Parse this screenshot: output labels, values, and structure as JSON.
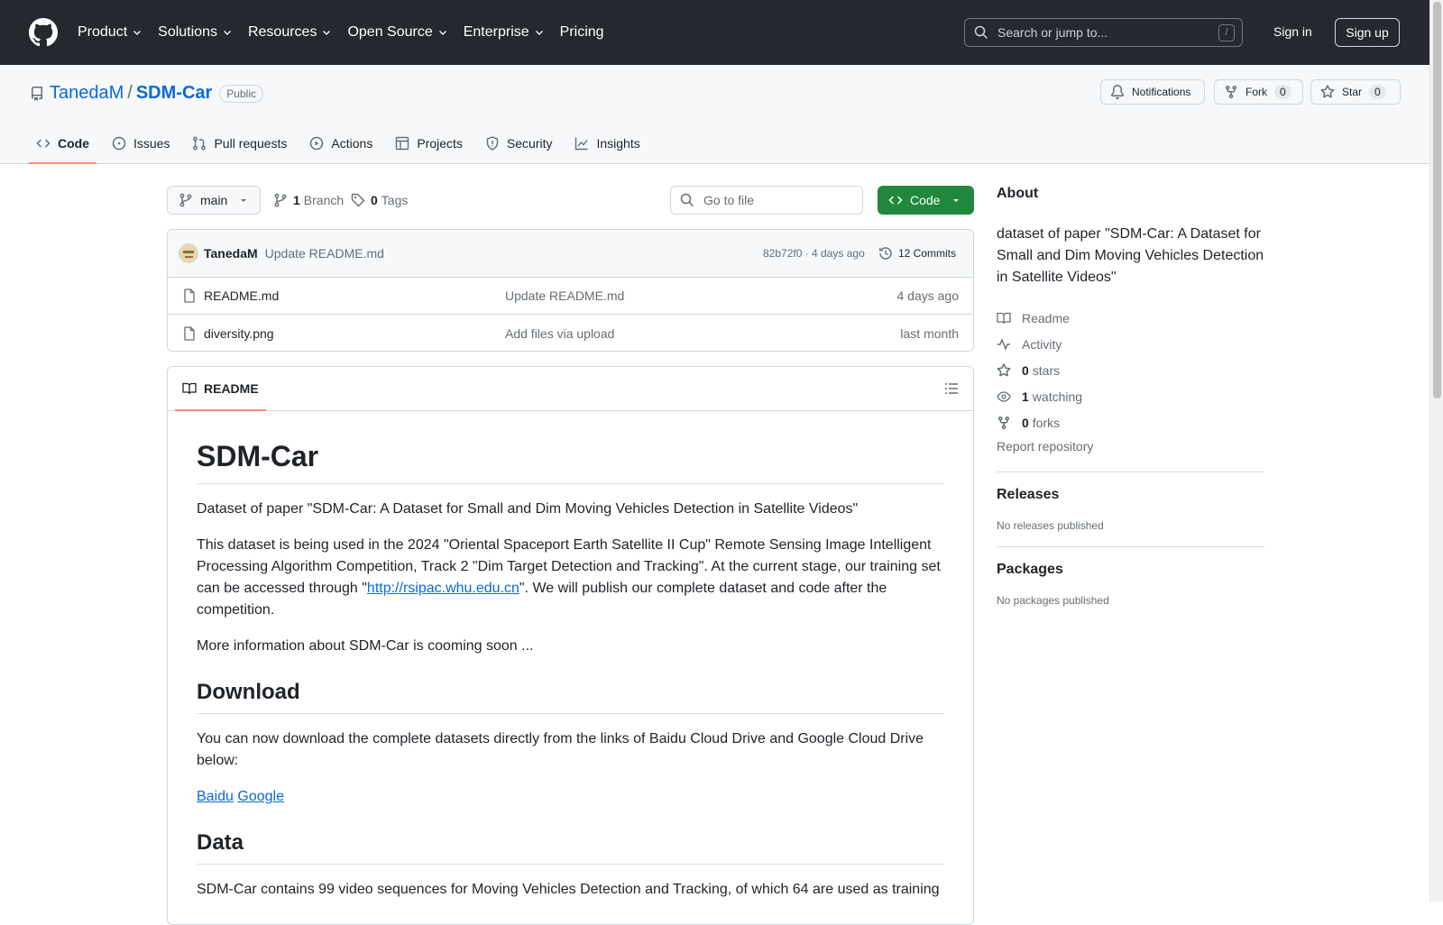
{
  "topnav": {
    "items": [
      "Product",
      "Solutions",
      "Resources",
      "Open Source",
      "Enterprise",
      "Pricing"
    ],
    "search_placeholder": "Search or jump to...",
    "search_shortcut": "/",
    "signin": "Sign in",
    "signup": "Sign up"
  },
  "repo": {
    "owner": "TanedaM",
    "separator": "/",
    "name": "SDM-Car",
    "visibility": "Public",
    "notifications": "Notifications",
    "fork_label": "Fork",
    "fork_count": "0",
    "star_label": "Star",
    "star_count": "0"
  },
  "tabs": [
    "Code",
    "Issues",
    "Pull requests",
    "Actions",
    "Projects",
    "Security",
    "Insights"
  ],
  "toolbar": {
    "branch": "main",
    "branch_count": "1",
    "branch_label": "Branch",
    "tag_count": "0",
    "tag_label": "Tags",
    "goto_placeholder": "Go to file",
    "code_button": "Code"
  },
  "latest_commit": {
    "author": "TanedaM",
    "message": "Update README.md",
    "sha_time": "82b72f0 · 4 days ago",
    "commits": "12 Commits"
  },
  "files": [
    {
      "name": "README.md",
      "message": "Update README.md",
      "date": "4 days ago"
    },
    {
      "name": "diversity.png",
      "message": "Add files via upload",
      "date": "last month"
    }
  ],
  "readme": {
    "tab": "README",
    "title": "SDM-Car",
    "p1": "Dataset of paper \"SDM-Car: A Dataset for Small and Dim Moving Vehicles Detection in Satellite Videos\"",
    "p2_before": "This dataset is being used in the 2024 \"Oriental Spaceport Earth Satellite II Cup\" Remote Sensing Image Intelligent Processing Algorithm Competition, Track 2 \"Dim Target Detection and Tracking\". At the current stage, our training set can be accessed through \"",
    "p2_link": "http://rsipac.whu.edu.cn",
    "p2_after": "\". We will publish our complete dataset and code after the competition.",
    "p3": "More information about SDM-Car is cooming soon ...",
    "h_download": "Download",
    "p4": "You can now download the complete datasets directly from the links of Baidu Cloud Drive and Google Cloud Drive below:",
    "link_baidu": "Baidu",
    "link_google": "Google",
    "h_data": "Data",
    "p5": "SDM-Car contains 99 video sequences for Moving Vehicles Detection and Tracking, of which 64 are used as training"
  },
  "about": {
    "title": "About",
    "description": "dataset of paper \"SDM-Car: A Dataset for Small and Dim Moving Vehicles Detection in Satellite Videos\"",
    "readme": "Readme",
    "activity": "Activity",
    "stars_count": "0",
    "stars_label": "stars",
    "watching_count": "1",
    "watching_label": "watching",
    "forks_count": "0",
    "forks_label": "forks",
    "report": "Report repository"
  },
  "releases": {
    "title": "Releases",
    "empty": "No releases published"
  },
  "packages": {
    "title": "Packages",
    "empty": "No packages published"
  }
}
